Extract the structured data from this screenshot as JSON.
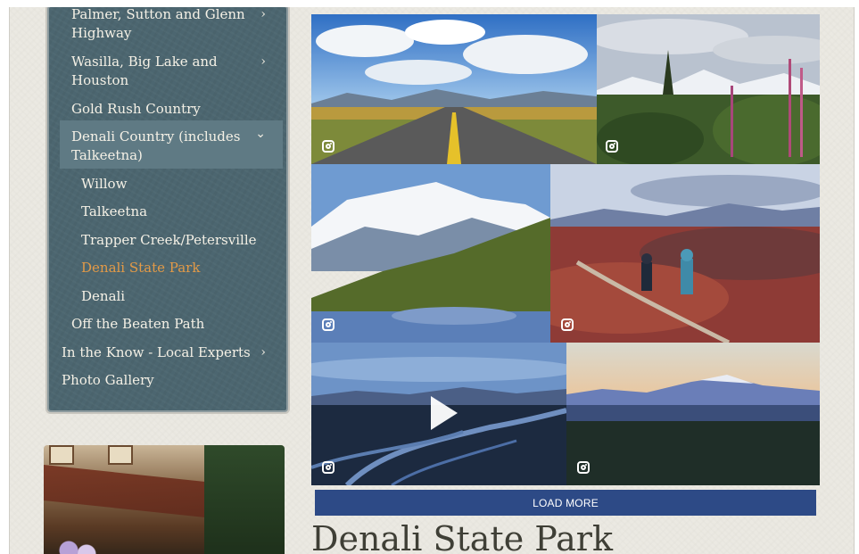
{
  "sidebar": {
    "items": [
      {
        "label_line1": "Palmer, Sutton and Glenn",
        "label_line2": "Highway",
        "chevron": "›"
      },
      {
        "label_line1": "Wasilla, Big Lake and",
        "label_line2": "Houston",
        "chevron": "›"
      },
      {
        "label": "Gold Rush Country"
      },
      {
        "label_line1": "Denali Country (includes",
        "label_line2": "Talkeetna)",
        "chevron": "⌄"
      },
      {
        "label": "Willow"
      },
      {
        "label": "Talkeetna"
      },
      {
        "label": "Trapper Creek/Petersville"
      },
      {
        "label": "Denali State Park",
        "active": true
      },
      {
        "label": "Denali"
      },
      {
        "label": "Off the Beaten Path"
      },
      {
        "label": "In the Know - Local Experts",
        "chevron": "›"
      },
      {
        "label": "Photo Gallery"
      }
    ]
  },
  "gallery": {
    "tiles": [
      {
        "scene": "highway-road",
        "icon": "instagram-icon"
      },
      {
        "scene": "fireweed-mountains",
        "icon": "instagram-icon"
      },
      {
        "scene": "denali-reflection",
        "icon": "instagram-icon"
      },
      {
        "scene": "hikers-tundra",
        "icon": "instagram-icon"
      },
      {
        "scene": "braided-river-video",
        "icon": "instagram-icon",
        "video": true
      },
      {
        "scene": "denali-dusk",
        "icon": "instagram-icon"
      }
    ],
    "load_more_label": "LOAD MORE"
  },
  "content": {
    "title": "Denali State Park"
  },
  "colors": {
    "sidebar_bg": "#4c6670",
    "active_link": "#e39a47",
    "button_bg": "#2d4a86",
    "page_bg": "#ebe9e2"
  }
}
